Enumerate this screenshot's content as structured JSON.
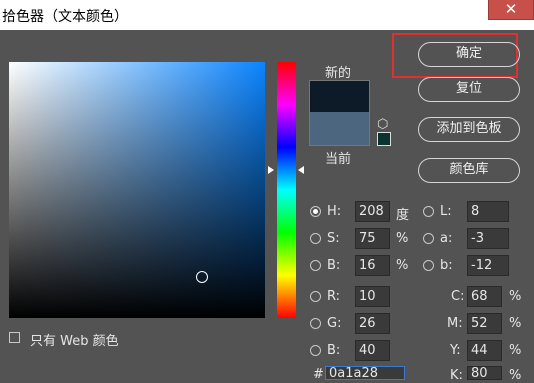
{
  "window": {
    "title": "拾色器（文本颜色）",
    "close_glyph": "✕"
  },
  "preview": {
    "new_label": "新的",
    "current_label": "当前",
    "new_color": "#0d1a28",
    "current_color": "#4c6680"
  },
  "buttons": {
    "ok": "确定",
    "reset": "复位",
    "add_to_swatches": "添加到色板",
    "color_libraries": "颜色库"
  },
  "hsb": {
    "h_label": "H:",
    "h_value": "208",
    "h_unit": "度",
    "s_label": "S:",
    "s_value": "75",
    "s_unit": "%",
    "b_label": "B:",
    "b_value": "16",
    "b_unit": "%"
  },
  "lab": {
    "l_label": "L:",
    "l_value": "8",
    "a_label": "a:",
    "a_value": "-3",
    "b_label": "b:",
    "b_value": "-12"
  },
  "rgb": {
    "r_label": "R:",
    "r_value": "10",
    "g_label": "G:",
    "g_value": "26",
    "b_label": "B:",
    "b_value": "40"
  },
  "cmyk": {
    "c_label": "C:",
    "c_value": "68",
    "c_unit": "%",
    "m_label": "M:",
    "m_value": "52",
    "m_unit": "%",
    "y_label": "Y:",
    "y_value": "44",
    "y_unit": "%",
    "k_label": "K:",
    "k_value": "80",
    "k_unit": "%"
  },
  "hex": {
    "hash_label": "#",
    "value": "0a1a28"
  },
  "web_only": {
    "label": "只有 Web 颜色",
    "checked": false
  },
  "icons": {
    "cube": "⬡"
  }
}
